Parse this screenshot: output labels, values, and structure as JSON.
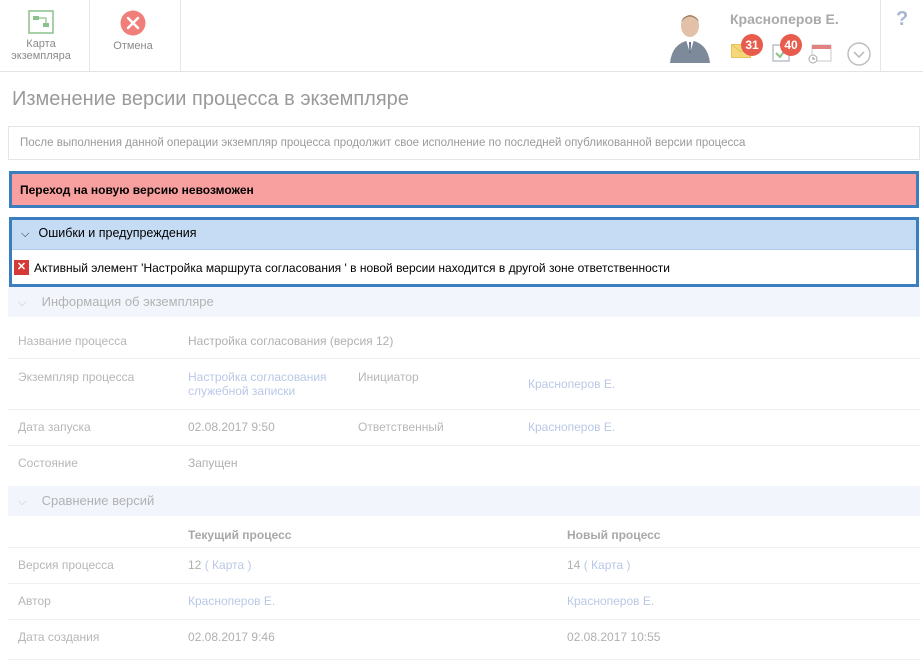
{
  "toolbar": {
    "map_label": "Карта экземпляра",
    "cancel_label": "Отмена"
  },
  "user": {
    "name": "Красноперов Е.",
    "mail_count": "31",
    "tasks_count": "40"
  },
  "help": "?",
  "page": {
    "title": "Изменение версии процесса в экземпляре",
    "info": "После выполнения данной операции экземпляр процесса продолжит свое исполнение по последней опубликованной версии процесса",
    "error": "Переход на новую версию невозможен"
  },
  "warnings": {
    "title": "Ошибки и предупреждения",
    "items": [
      "Активный элемент 'Настройка маршрута согласования ' в новой версии находится в другой зоне ответственности"
    ]
  },
  "instance_info": {
    "title": "Информация об экземпляре",
    "process_name_label": "Название процесса",
    "process_name": "Настройка согласования (версия 12)",
    "instance_label": "Экземпляр процесса",
    "instance_line1": "Настройка согласования",
    "instance_line2": "служебной записки",
    "initiator_label": "Инициатор",
    "initiator": "Красноперов Е.",
    "start_date_label": "Дата запуска",
    "start_date": "02.08.2017 9:50",
    "responsible_label": "Ответственный",
    "responsible": "Красноперов Е.",
    "state_label": "Состояние",
    "state": "Запущен"
  },
  "compare": {
    "title": "Сравнение версий",
    "current_header": "Текущий процесс",
    "new_header": "Новый процесс",
    "version_label": "Версия процесса",
    "current_version": "12",
    "new_version": "14",
    "map_link": "Карта",
    "author_label": "Автор",
    "current_author": "Красноперов Е.",
    "new_author": "Красноперов Е.",
    "created_label": "Дата создания",
    "current_created": "02.08.2017 9:46",
    "new_created": "02.08.2017 10:55"
  },
  "colors": {
    "error_bg": "#f8a09f",
    "highlight_border": "#3a7ec0",
    "warn_header_bg": "#c6dcf5",
    "badge": "#e85c4d"
  }
}
